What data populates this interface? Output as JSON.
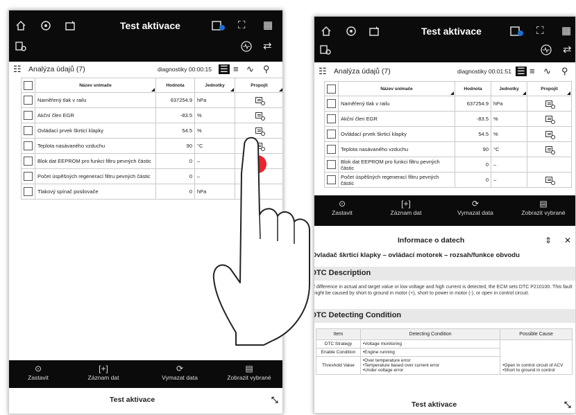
{
  "screen_title": "Test aktivace",
  "toolbar": {
    "section_title": "Analýza údajů (7)",
    "left_timer": "diagnostiky 00:00:15",
    "right_timer": "diagnostiky 00:01:51"
  },
  "table": {
    "headers": {
      "name": "Název snímače",
      "value": "Hodnota",
      "units": "Jednotky",
      "link": "Propojit"
    },
    "left_rows": [
      {
        "name": "Naměřený tlak v railu",
        "value": "637254.9",
        "unit": "hPa",
        "link": true
      },
      {
        "name": "Akční člen EGR",
        "value": "-83.5",
        "unit": "%",
        "link": true
      },
      {
        "name": "Ovládací prvek škrticí klapky",
        "value": "54.5",
        "unit": "%",
        "link": true
      },
      {
        "name": "Teplota nasávaného vzduchu",
        "value": "90",
        "unit": "°C",
        "link": true
      },
      {
        "name": "Blok dat EEPROM pro funkci filtru pevných částic",
        "value": "0",
        "unit": "–",
        "link": false
      },
      {
        "name": "Počet úspěšných regenerací filtru pevných částic",
        "value": "0",
        "unit": "–",
        "link": false
      },
      {
        "name": "Tlakový spínač posilovače",
        "value": "0",
        "unit": "hPa",
        "link": false
      }
    ],
    "right_rows": [
      {
        "name": "Naměřený tlak v railu",
        "value": "637254.9",
        "unit": "hPa",
        "link": true
      },
      {
        "name": "Akční člen EGR",
        "value": "-83.5",
        "unit": "%",
        "link": true
      },
      {
        "name": "Ovládací prvek škrticí klapky",
        "value": "54.5",
        "unit": "%",
        "link": true
      },
      {
        "name": "Teplota nasávaného vzduchu",
        "value": "90",
        "unit": "°C",
        "link": true
      },
      {
        "name": "Blok dat EEPROM pro funkci filtru pevných částic",
        "value": "0",
        "unit": "–",
        "link": false
      },
      {
        "name": "Počet úspěšných regenerací filtru pevných částic",
        "value": "0",
        "unit": "–",
        "link": true
      }
    ]
  },
  "bottom_bar": {
    "stop": "Zastavit",
    "record": "Záznam dat",
    "clear": "Vymazat data",
    "show_selected": "Zobrazit vybrané"
  },
  "info_panel": {
    "title": "Informace o datech",
    "subtitle": "Ovladač škrticí klapky – ovládací motorek – rozsah/funkce obvodu",
    "dtc_description_heading": "DTC Description",
    "dtc_description_text": "If difference in actual and target value or low voltage and high current is detected, the ECM sets DTC P210100. This fault might be caused by short to ground in motor (+), short to power in motor (-), or open in control circuit.",
    "dtc_detecting_heading": "DTC Detecting Condition",
    "dtc_table": {
      "headers": [
        "Item",
        "Detecting Condition",
        "Possible Cause"
      ],
      "rows": [
        {
          "item": "DTC Strategy",
          "condition": [
            "•Voltage monitoring"
          ]
        },
        {
          "item": "Enable Condition",
          "condition": [
            "•Engine running"
          ]
        },
        {
          "item": "Threshold Value",
          "condition": [
            "•Over temperature error",
            "•Temperature based over current error",
            "•Under voltage error"
          ]
        }
      ],
      "possible_cause": [
        "•Open in control circuit of ACV",
        "•Short to ground in control"
      ]
    }
  },
  "colors": {
    "bar": "#0b0b0b",
    "tap_marker": "#e8242c",
    "section_bg": "#e8e8e8"
  }
}
